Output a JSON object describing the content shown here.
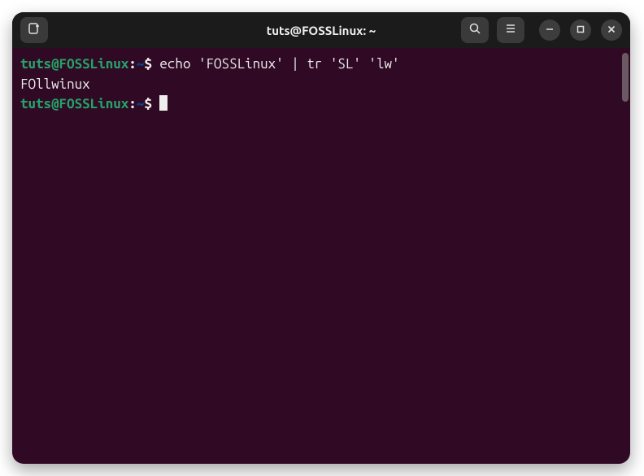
{
  "titlebar": {
    "title": "tuts@FOSSLinux: ~"
  },
  "terminal": {
    "lines": [
      {
        "user": "tuts@FOSSLinux",
        "path": "~",
        "command": "echo 'FOSSLinux' | tr 'SL' 'lw'"
      }
    ],
    "output": "FOllwinux",
    "prompt2": {
      "user": "tuts@FOSSLinux",
      "path": "~"
    }
  },
  "icons": {
    "newTab": "new-tab-icon",
    "search": "search-icon",
    "menu": "menu-icon",
    "minimize": "minimize-icon",
    "maximize": "maximize-icon",
    "close": "close-icon"
  }
}
